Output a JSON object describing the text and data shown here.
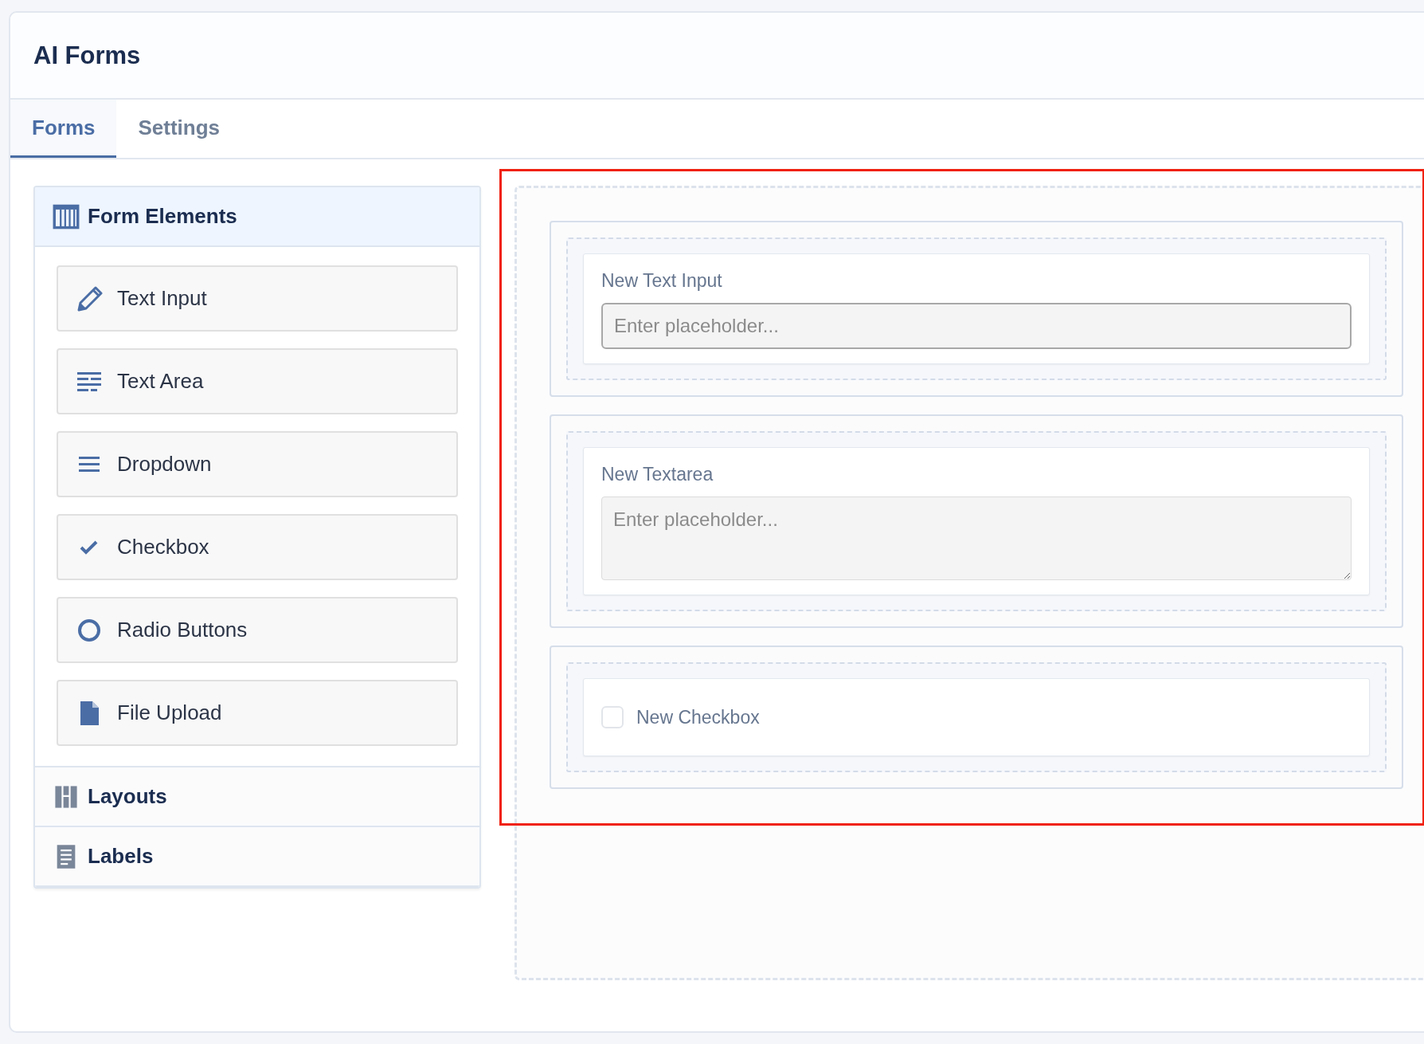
{
  "header": {
    "title": "AI Forms"
  },
  "tabs": [
    {
      "label": "Forms",
      "selected": true
    },
    {
      "label": "Settings",
      "selected": false
    }
  ],
  "sidebar": {
    "sections": [
      {
        "kind": "columns",
        "title": "Form Elements",
        "expanded": true,
        "items": [
          {
            "kind": "pencil",
            "label": "Text Input"
          },
          {
            "kind": "lines",
            "label": "Text Area"
          },
          {
            "kind": "menu",
            "label": "Dropdown"
          },
          {
            "kind": "check",
            "label": "Checkbox"
          },
          {
            "kind": "ring",
            "label": "Radio Buttons"
          },
          {
            "kind": "file",
            "label": "File Upload"
          }
        ]
      },
      {
        "kind": "layout",
        "title": "Layouts",
        "expanded": false
      },
      {
        "kind": "document",
        "title": "Labels",
        "expanded": false
      }
    ]
  },
  "canvas": {
    "highlighted": true,
    "fields": [
      {
        "kind": "text",
        "label": "New Text Input",
        "placeholder": "Enter placeholder..."
      },
      {
        "kind": "textarea",
        "label": "New Textarea",
        "placeholder": "Enter placeholder..."
      },
      {
        "kind": "checkbox",
        "label": "New Checkbox",
        "checked": false
      }
    ]
  }
}
